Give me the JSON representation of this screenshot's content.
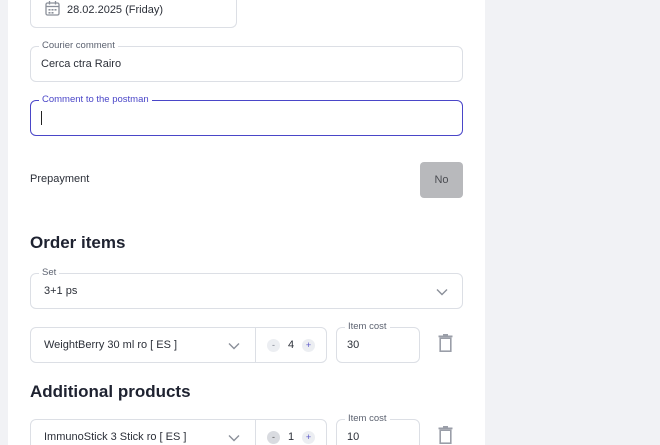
{
  "delivery": {
    "date_value": "28.02.2025 (Friday)"
  },
  "courier_comment": {
    "label": "Courier comment",
    "value": "Cerca ctra Rairo"
  },
  "postman_comment": {
    "label": "Comment to the postman",
    "value": ""
  },
  "prepayment": {
    "label": "Prepayment",
    "button_label": "No"
  },
  "order_items": {
    "title": "Order items",
    "set_label": "Set",
    "set_value": "3+1 ps",
    "items": [
      {
        "product": "WeightBerry 30 ml ro [ ES ]",
        "quantity": "4",
        "cost_label": "Item cost",
        "cost": "30"
      }
    ]
  },
  "additional_products": {
    "title": "Additional products",
    "items": [
      {
        "product": "ImmunoStick 3 Stick ro [ ES ]",
        "quantity": "1",
        "cost_label": "Item cost",
        "cost": "10"
      }
    ]
  },
  "stepper": {
    "minus": "-",
    "plus": "+"
  },
  "colors": {
    "accent": "#4a46c8",
    "border": "#dcdfe5",
    "prepay_bg": "#b8b9bc"
  }
}
